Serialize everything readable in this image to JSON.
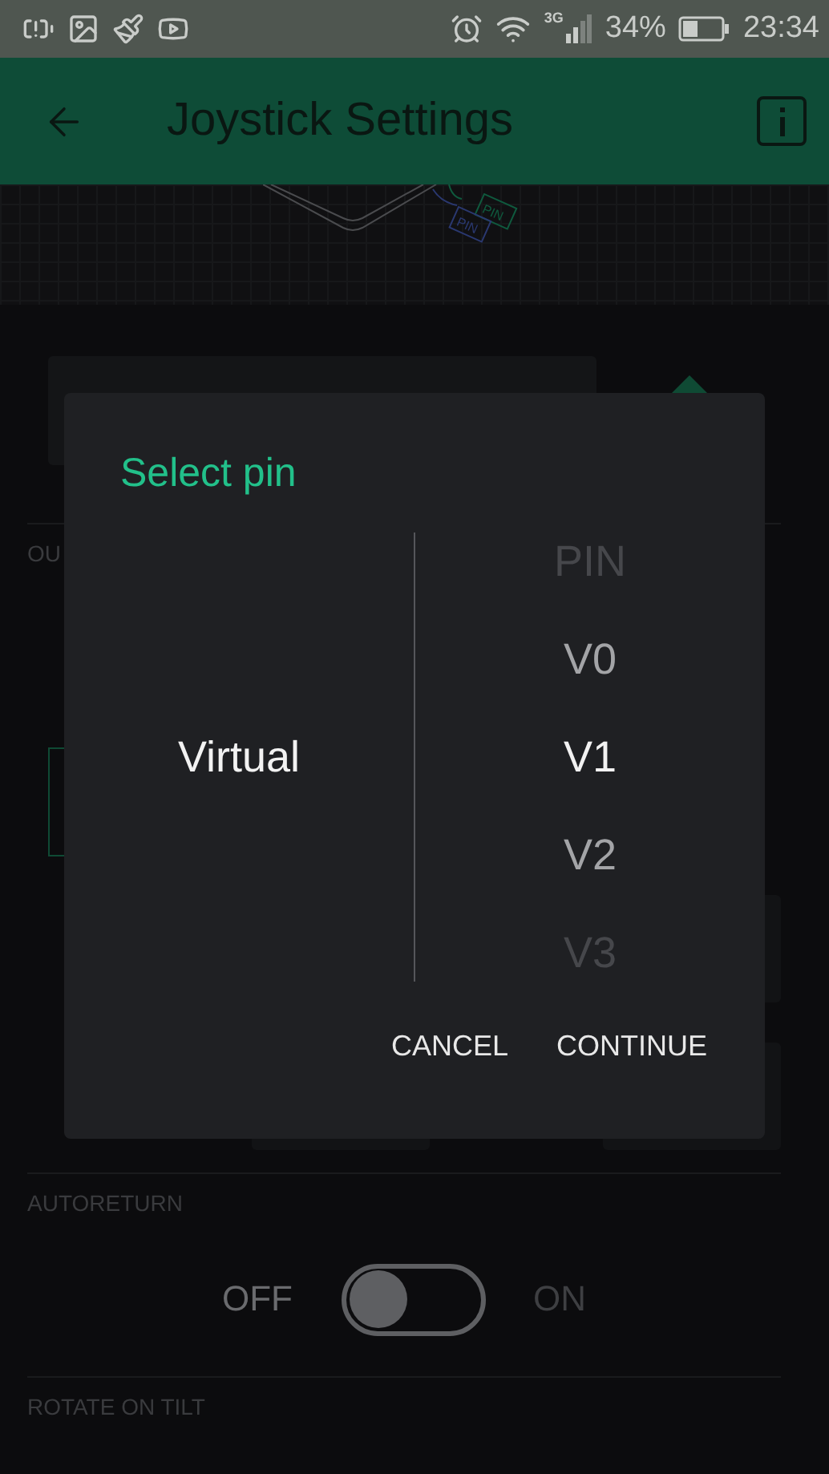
{
  "status_bar": {
    "network": "3G",
    "battery": "34%",
    "time": "23:34"
  },
  "app_bar": {
    "title": "Joystick Settings"
  },
  "illustration": {
    "pin_labels": [
      "PIN",
      "PIN"
    ]
  },
  "output": {
    "label": "OU"
  },
  "dialog": {
    "title": "Select pin",
    "type_options": [
      {
        "label": "Virtual",
        "selected": true
      }
    ],
    "pin_options": [
      {
        "label": "PIN",
        "selected": false
      },
      {
        "label": "V0",
        "selected": false
      },
      {
        "label": "V1",
        "selected": true
      },
      {
        "label": "V2",
        "selected": false
      },
      {
        "label": "V3",
        "selected": false
      }
    ],
    "buttons": [
      "CANCEL",
      "CONTINUE"
    ]
  },
  "autoreturn": {
    "label": "AUTORETURN",
    "off_label": "OFF",
    "on_label": "ON",
    "on": false
  },
  "rotate": {
    "label": "ROTATE ON TILT"
  }
}
